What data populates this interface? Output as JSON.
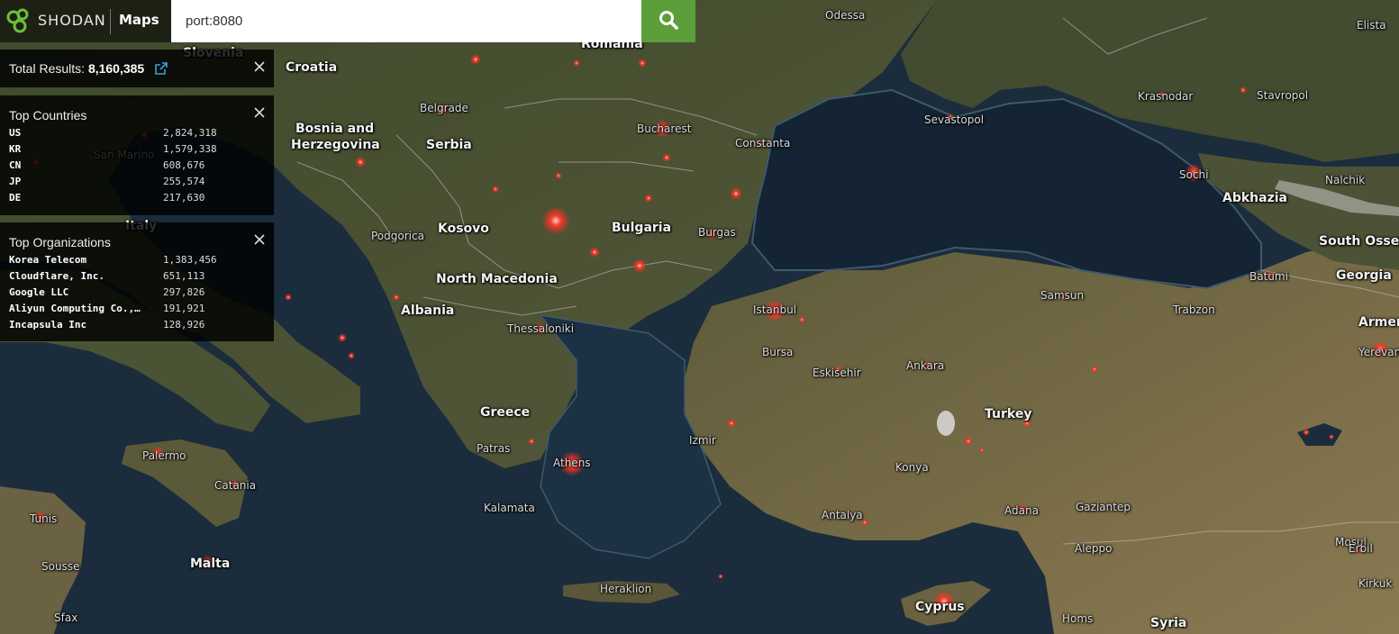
{
  "app": {
    "brand": "SHODAN",
    "section": "Maps",
    "logo_icon": "shodan-logo-icon",
    "accent": "#5c9e3a"
  },
  "search": {
    "value": "port:8080",
    "button_icon": "search-icon"
  },
  "total": {
    "label": "Total Results:",
    "value": "8,160,385",
    "link_icon": "external-link-icon"
  },
  "top_countries": {
    "title": "Top Countries",
    "items": [
      {
        "name": "US",
        "value": "2,824,318"
      },
      {
        "name": "KR",
        "value": "1,579,338"
      },
      {
        "name": "CN",
        "value": "608,676"
      },
      {
        "name": "JP",
        "value": "255,574"
      },
      {
        "name": "DE",
        "value": "217,630"
      }
    ]
  },
  "top_organizations": {
    "title": "Top Organizations",
    "items": [
      {
        "name": "Korea Telecom",
        "value": "1,383,456"
      },
      {
        "name": "Cloudflare, Inc.",
        "value": "651,113"
      },
      {
        "name": "Google LLC",
        "value": "297,826"
      },
      {
        "name": "Aliyun Computing Co.,…",
        "value": "191,921"
      },
      {
        "name": "Incapsula Inc",
        "value": "128,926"
      }
    ]
  },
  "map": {
    "labels": [
      {
        "text": "Croatia",
        "kind": "country"
      },
      {
        "text": "Bosnia and",
        "kind": "country"
      },
      {
        "text": "Herzegovina",
        "kind": "country"
      },
      {
        "text": "Serbia",
        "kind": "country"
      },
      {
        "text": "Kosovo",
        "kind": "country"
      },
      {
        "text": "Bulgaria",
        "kind": "country"
      },
      {
        "text": "North Macedonia",
        "kind": "country"
      },
      {
        "text": "Albania",
        "kind": "country"
      },
      {
        "text": "Greece",
        "kind": "country"
      },
      {
        "text": "Turkey",
        "kind": "country"
      },
      {
        "text": "Italy",
        "kind": "country"
      },
      {
        "text": "Abkhazia",
        "kind": "country"
      },
      {
        "text": "South Osset",
        "kind": "country"
      },
      {
        "text": "Georgia",
        "kind": "country"
      },
      {
        "text": "Armen",
        "kind": "country"
      },
      {
        "text": "Cyprus",
        "kind": "country"
      },
      {
        "text": "Syria",
        "kind": "country"
      },
      {
        "text": "Malta",
        "kind": "country"
      },
      {
        "text": "Slovenia",
        "kind": "country"
      },
      {
        "text": "Romania",
        "kind": "country"
      },
      {
        "text": "Odessa",
        "kind": "city"
      },
      {
        "text": "Elista",
        "kind": "city"
      },
      {
        "text": "Krasnodar",
        "kind": "city"
      },
      {
        "text": "Stavropol",
        "kind": "city"
      },
      {
        "text": "Sevastopol",
        "kind": "city"
      },
      {
        "text": "Belgrade",
        "kind": "city"
      },
      {
        "text": "Bucharest",
        "kind": "city"
      },
      {
        "text": "Constanta",
        "kind": "city"
      },
      {
        "text": "San Marino",
        "kind": "city"
      },
      {
        "text": "Sochi",
        "kind": "city"
      },
      {
        "text": "Nalchik",
        "kind": "city"
      },
      {
        "text": "Podgorica",
        "kind": "city"
      },
      {
        "text": "Burgas",
        "kind": "city"
      },
      {
        "text": "Batumi",
        "kind": "city"
      },
      {
        "text": "Samsun",
        "kind": "city"
      },
      {
        "text": "Trabzon",
        "kind": "city"
      },
      {
        "text": "Istanbul",
        "kind": "city"
      },
      {
        "text": "Thessaloniki",
        "kind": "city"
      },
      {
        "text": "Bursa",
        "kind": "city"
      },
      {
        "text": "Eskisehir",
        "kind": "city"
      },
      {
        "text": "Ankara",
        "kind": "city"
      },
      {
        "text": "Yerevan",
        "kind": "city"
      },
      {
        "text": "Izmir",
        "kind": "city"
      },
      {
        "text": "Patras",
        "kind": "city"
      },
      {
        "text": "Athens",
        "kind": "city"
      },
      {
        "text": "Palermo",
        "kind": "city"
      },
      {
        "text": "Catania",
        "kind": "city"
      },
      {
        "text": "Konya",
        "kind": "city"
      },
      {
        "text": "Kalamata",
        "kind": "city"
      },
      {
        "text": "Tunis",
        "kind": "city"
      },
      {
        "text": "Antalya",
        "kind": "city"
      },
      {
        "text": "Adana",
        "kind": "city"
      },
      {
        "text": "Gaziantep",
        "kind": "city"
      },
      {
        "text": "Mosul",
        "kind": "city"
      },
      {
        "text": "Erbil",
        "kind": "city"
      },
      {
        "text": "Sousse",
        "kind": "city"
      },
      {
        "text": "Aleppo",
        "kind": "city"
      },
      {
        "text": "Kirkuk",
        "kind": "city"
      },
      {
        "text": "Heraklion",
        "kind": "city"
      },
      {
        "text": "Sfax",
        "kind": "city"
      },
      {
        "text": "Homs",
        "kind": "city"
      }
    ]
  }
}
